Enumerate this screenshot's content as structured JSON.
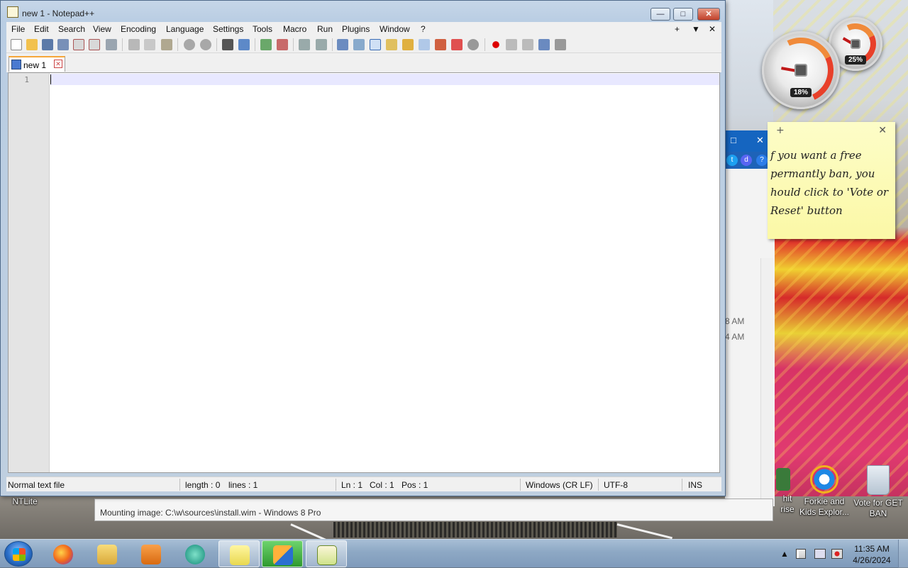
{
  "window": {
    "title": "new 1 - Notepad++",
    "close_label": "✕",
    "maximize_label": "□",
    "minimize_label": "—"
  },
  "menu": {
    "items": [
      "File",
      "Edit",
      "Search",
      "View",
      "Encoding",
      "Language",
      "Settings",
      "Tools",
      "Macro",
      "Run",
      "Plugins",
      "Window",
      "?"
    ],
    "right_plus": "+",
    "right_arrow": "▼",
    "right_close": "✕"
  },
  "tab": {
    "name": "new 1"
  },
  "editor": {
    "line_number": "1",
    "content": ""
  },
  "status": {
    "file_type": "Normal text file",
    "length": "length : 0",
    "lines": "lines : 1",
    "ln": "Ln : 1",
    "col": "Col : 1",
    "pos": "Pos : 1",
    "eol": "Windows (CR LF)",
    "encoding": "UTF-8",
    "mode": "INS"
  },
  "gadgets": {
    "cpu": "18%",
    "memory": "25%"
  },
  "sticky_note": {
    "plus": "+",
    "close": "✕",
    "text": "f you want a free permantly ban, you hould click to 'Vote or Reset' button"
  },
  "background_window": {
    "max": "□",
    "close": "✕",
    "time1": "8 AM",
    "time2": "4 AM"
  },
  "mount_status": {
    "label": "Mounting image: C:\\w\\sources\\install.wim - Windows 8 Pro"
  },
  "desktop_icons": {
    "ntlite": "NTLite",
    "partial": "hit\nrise",
    "forkie": "Forkie and Kids Explor...",
    "vote": "Vote for GET BAN"
  },
  "taskbar": {
    "clock_time": "11:35 AM",
    "clock_date": "4/26/2024",
    "tray_up": "▲"
  },
  "colors": {
    "accent_tab": "#f6a73a",
    "current_line": "#e8e8ff",
    "close_red": "#c0402a"
  }
}
